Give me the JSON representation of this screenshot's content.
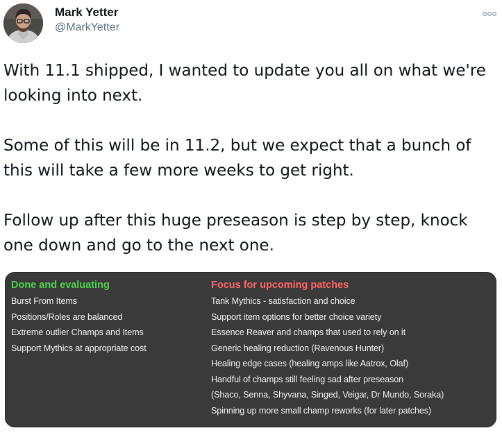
{
  "author": {
    "display_name": "Mark Yetter",
    "handle": "@MarkYetter",
    "avatar_icon": "avatar-photo"
  },
  "menu": {
    "icon": "more-options-icon"
  },
  "tweet": {
    "paragraphs": [
      "With 11.1 shipped, I wanted to update you all on what we're looking into next.",
      "Some of this will be in 11.2, but we expect that a bunch of this will take a few more weeks to get right.",
      "Follow up after this huge preseason is step by step, knock one down and go to the next one."
    ]
  },
  "image": {
    "left": {
      "heading": "Done and evaluating",
      "color": "#4fd34f",
      "items": [
        "Burst From Items",
        "Positions/Roles are balanced",
        "Extreme outlier Champs and Items",
        "Support Mythics at appropriate cost"
      ]
    },
    "right": {
      "heading": "Focus for upcoming patches",
      "color": "#ff6666",
      "items": [
        "Tank Mythics - satisfaction and choice",
        "Support item options for better choice variety",
        "Essence Reaver and champs that used to rely on it",
        "Generic healing reduction (Ravenous Hunter)",
        "Healing edge cases (healing amps like Aatrox, Olaf)",
        "Handful of champs still feeling sad after preseason",
        "(Shaco, Senna, Shyvana, Singed, Veigar, Dr Mundo, Soraka)",
        "Spinning up more small champ reworks (for later patches)"
      ]
    }
  }
}
